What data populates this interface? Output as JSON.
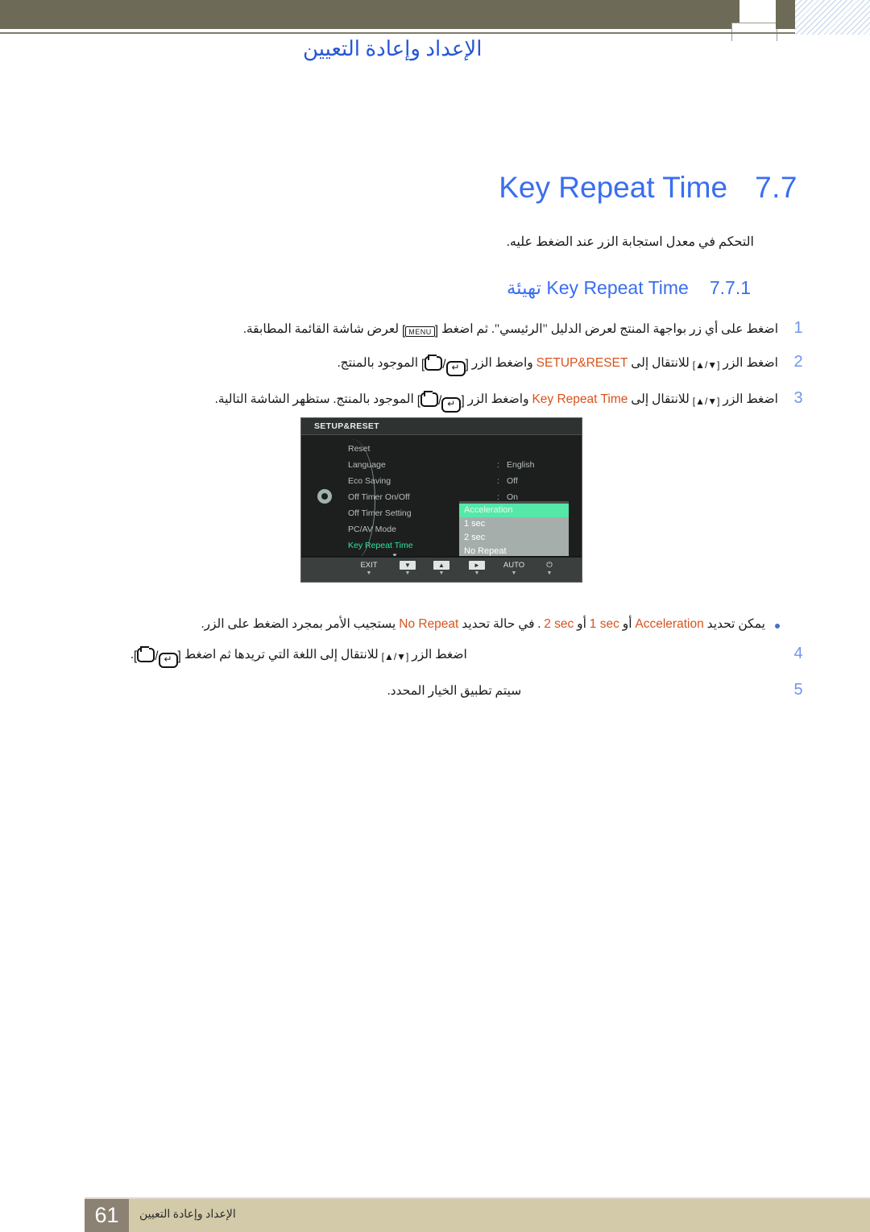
{
  "header": {
    "title": "الإعداد وإعادة التعيين"
  },
  "section": {
    "number": "7.7",
    "title": "Key Repeat Time",
    "intro": "التحكم في معدل استجابة الزر عند الضغط عليه."
  },
  "subsection": {
    "number": "7.7.1",
    "prefix_ar": "تهيئة",
    "title_latin": "Key Repeat Time"
  },
  "steps": [
    {
      "num": "1",
      "pre": "اضغط على أي زر بواجهة المنتج لعرض الدليل \"الرئيسي\". ثم اضغط",
      "chip": "MENU",
      "post": "لعرض شاشة القائمة المطابقة."
    },
    {
      "num": "2",
      "seg_a": "اضغط الزر",
      "updown": "[▲/▼]",
      "seg_b": "للانتقال إلى",
      "keyword": "SETUP&RESET",
      "seg_c": "واضغط الزر",
      "seg_d": "الموجود بالمنتج."
    },
    {
      "num": "3",
      "seg_a": "اضغط الزر",
      "updown": "[▲/▼]",
      "seg_b": "للانتقال إلى",
      "keyword": "Key Repeat Time",
      "seg_c": "واضغط الزر",
      "seg_d": "الموجود بالمنتج. ستظهر الشاشة التالية."
    },
    {
      "num": "4",
      "seg_a": "اضغط الزر",
      "updown": "[▲/▼]",
      "seg_b": "للانتقال إلى اللغة التي تريدها ثم اضغط",
      "seg_d": "."
    },
    {
      "num": "5",
      "text": "سيتم تطبيق الخيار المحدد."
    }
  ],
  "bullet": {
    "seg_a": "يمكن تحديد",
    "kw1": "Acceleration",
    "or1": "أو",
    "kw2": "1 sec",
    "or2": "أو",
    "kw3": "2 sec",
    "seg_b": ". في حالة تحديد",
    "kw4": "No Repeat",
    "seg_c": "يستجيب الأمر بمجرد الضغط على الزر."
  },
  "osd": {
    "header": "SETUP&RESET",
    "rows": [
      {
        "label": "Reset",
        "colon": "",
        "value": ""
      },
      {
        "label": "Language",
        "colon": ":",
        "value": "English"
      },
      {
        "label": "Eco Saving",
        "colon": ":",
        "value": "Off"
      },
      {
        "label": "Off Timer On/Off",
        "colon": ":",
        "value": "On"
      },
      {
        "label": "Off Timer Setting",
        "colon": ":",
        "value": ""
      },
      {
        "label": "PC/AV Mode",
        "colon": ":",
        "value": ""
      },
      {
        "label": "Key Repeat Time",
        "colon": ":",
        "value": ""
      }
    ],
    "active_row_index": 6,
    "popup_options": [
      {
        "label": "Acceleration",
        "selected": true
      },
      {
        "label": "1 sec",
        "selected": false
      },
      {
        "label": "2 sec",
        "selected": false
      },
      {
        "label": "No Repeat",
        "selected": false
      }
    ],
    "footer_buttons": [
      {
        "label": "EXIT",
        "type": "text"
      },
      {
        "label": "▼",
        "type": "key"
      },
      {
        "label": "▲",
        "type": "key"
      },
      {
        "label": "►",
        "type": "key"
      },
      {
        "label": "AUTO",
        "type": "text"
      },
      {
        "label": "⏻",
        "type": "text"
      }
    ],
    "scroll_hint": "▼"
  },
  "footer": {
    "page_number": "61",
    "text": "الإعداد وإعادة التعيين"
  },
  "colors": {
    "accent_blue": "#3a6ef0",
    "keyword_orange": "#d8531c",
    "header_band": "#6d6a57",
    "footer_band": "#d2caa8",
    "footer_page_box": "#8b8273",
    "osd_highlight_green": "#55e8a9",
    "osd_active_label": "#2fe49b"
  }
}
